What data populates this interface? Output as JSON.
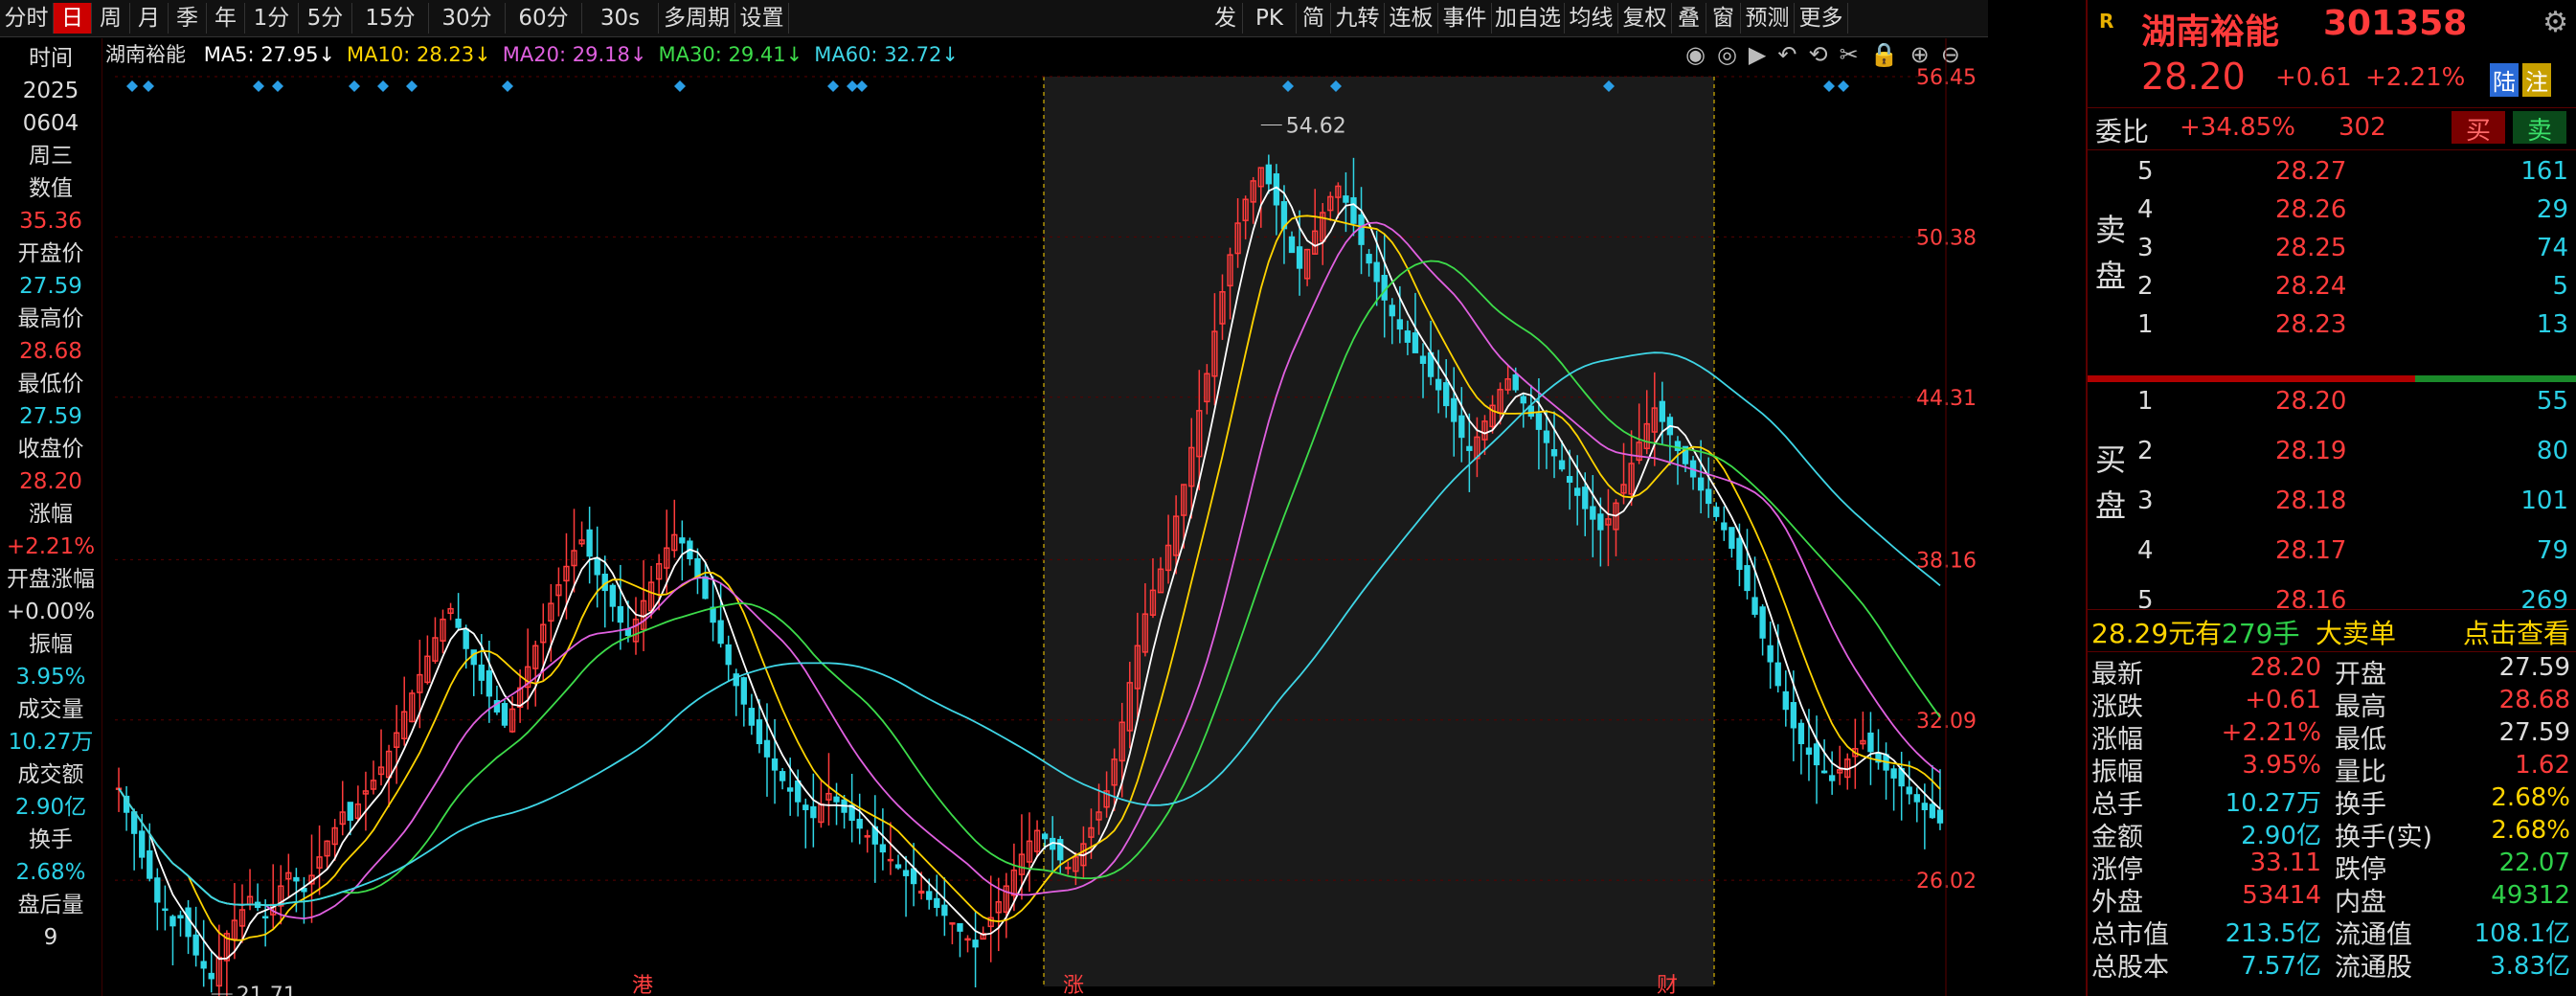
{
  "toolbar": {
    "items": [
      "分时",
      "日",
      "周",
      "月",
      "季",
      "年",
      "1分",
      "5分",
      "15分",
      "30分",
      "60分",
      "30s",
      "多周期",
      "设置"
    ],
    "active": "日",
    "right_items": [
      "发",
      "PK",
      "简",
      "九转",
      "连板",
      "事件",
      "加自选",
      "均线",
      "复权",
      "叠",
      "窗",
      "预测",
      "更多"
    ]
  },
  "left_panel": {
    "rows": [
      {
        "label": "时间",
        "value": "2025"
      },
      {
        "label": "",
        "value": "0604"
      },
      {
        "label": "周三",
        "value": ""
      },
      {
        "label": "数值",
        "value": "35.36"
      },
      {
        "label": "开盘价",
        "value": "27.59"
      },
      {
        "label": "最高价",
        "value": "28.68"
      },
      {
        "label": "最低价",
        "value": "27.59"
      },
      {
        "label": "收盘价",
        "value": "28.20"
      },
      {
        "label": "涨幅",
        "value": "+2.21%"
      },
      {
        "label": "开盘涨幅",
        "value": "+0.00%"
      },
      {
        "label": "振幅",
        "value": "3.95%"
      },
      {
        "label": "成交量",
        "value": "10.27万"
      },
      {
        "label": "成交额",
        "value": "2.90亿"
      },
      {
        "label": "换手",
        "value": "2.68%"
      },
      {
        "label": "盘后量",
        "value": "9"
      }
    ]
  },
  "chart_header": {
    "stock": "湖南裕能",
    "ma": [
      {
        "name": "MA5",
        "value": "27.95",
        "arrow": "↓",
        "color": "#ffffff"
      },
      {
        "name": "MA10",
        "value": "28.23",
        "arrow": "↓",
        "color": "#ffd400"
      },
      {
        "name": "MA20",
        "value": "29.18",
        "arrow": "↓",
        "color": "#e060e0"
      },
      {
        "name": "MA30",
        "value": "29.41",
        "arrow": "↓",
        "color": "#3ddc4a"
      },
      {
        "name": "MA60",
        "value": "32.72",
        "arrow": "↓",
        "color": "#3fd6e6"
      }
    ]
  },
  "chart_data": {
    "type": "candlestick",
    "y_ticks": [
      "56.45",
      "50.38",
      "44.31",
      "38.16",
      "32.09",
      "26.02"
    ],
    "ylim": [
      22.0,
      56.45
    ],
    "high_label": "54.62",
    "low_label": "21.71",
    "bottom_marks": [
      "涨",
      "财",
      "港"
    ],
    "closes": [
      29.5,
      28.6,
      27.8,
      26.9,
      26.1,
      25.2,
      24.9,
      24.3,
      24.6,
      23.9,
      23.2,
      22.7,
      22.3,
      23.1,
      24.0,
      24.5,
      24.9,
      25.4,
      25.0,
      24.6,
      25.1,
      25.8,
      26.3,
      26.0,
      25.6,
      26.2,
      26.9,
      27.5,
      28.0,
      28.6,
      28.3,
      28.9,
      29.4,
      29.8,
      30.3,
      30.9,
      31.6,
      32.4,
      33.1,
      33.8,
      34.5,
      35.2,
      35.9,
      36.3,
      35.6,
      34.8,
      34.2,
      33.6,
      33.0,
      32.4,
      31.9,
      32.5,
      33.3,
      34.1,
      34.9,
      35.7,
      36.5,
      37.2,
      37.9,
      38.5,
      38.9,
      38.3,
      37.6,
      37.0,
      36.4,
      35.8,
      35.3,
      35.9,
      36.6,
      37.3,
      38.0,
      38.6,
      39.1,
      38.8,
      38.2,
      37.5,
      36.7,
      35.8,
      35.0,
      34.2,
      33.4,
      32.7,
      31.9,
      31.2,
      30.7,
      30.2,
      29.8,
      29.4,
      29.0,
      28.7,
      28.4,
      28.9,
      29.3,
      29.0,
      28.6,
      28.3,
      28.0,
      27.7,
      27.4,
      27.1,
      26.8,
      26.5,
      26.2,
      25.9,
      25.6,
      25.3,
      25.0,
      24.7,
      24.4,
      24.1,
      23.8,
      23.5,
      24.0,
      24.6,
      25.2,
      25.8,
      26.4,
      27.0,
      27.5,
      27.9,
      27.6,
      27.2,
      26.8,
      26.5,
      26.9,
      27.4,
      28.0,
      28.6,
      29.4,
      30.6,
      32.0,
      33.5,
      34.9,
      36.1,
      37.0,
      37.8,
      38.7,
      39.8,
      41.0,
      42.4,
      43.8,
      45.2,
      46.8,
      48.3,
      49.7,
      50.9,
      51.8,
      52.5,
      53.0,
      52.4,
      51.6,
      50.7,
      49.8,
      49.2,
      49.9,
      50.6,
      51.3,
      51.9,
      52.3,
      51.7,
      50.9,
      50.1,
      49.4,
      48.7,
      48.0,
      47.4,
      46.9,
      46.4,
      46.0,
      45.6,
      45.1,
      44.6,
      44.0,
      43.4,
      42.8,
      42.3,
      42.8,
      43.4,
      44.0,
      44.6,
      45.0,
      44.6,
      44.1,
      43.6,
      43.1,
      42.6,
      42.1,
      41.6,
      41.1,
      40.6,
      40.1,
      39.7,
      39.3,
      39.7,
      40.3,
      41.0,
      41.8,
      42.6,
      43.3,
      43.9,
      43.4,
      42.9,
      42.3,
      41.8,
      41.3,
      40.8,
      40.3,
      39.8,
      39.3,
      38.6,
      37.8,
      37.0,
      36.1,
      35.2,
      34.3,
      33.4,
      32.5,
      31.8,
      31.2,
      30.8,
      30.4,
      30.1,
      29.8,
      30.2,
      30.6,
      31.0,
      31.3,
      30.9,
      30.5,
      30.2,
      29.9,
      29.6,
      29.3,
      29.0,
      28.7,
      28.4,
      28.2
    ]
  },
  "chart_toolbar_icons": [
    "eye-icon",
    "target-icon",
    "play-icon",
    "undo-icon",
    "rotate-icon",
    "scissors-icon",
    "lock-icon",
    "zoom-in-icon",
    "zoom-out-icon"
  ],
  "right_panel": {
    "badge": "R",
    "name": "湖南裕能",
    "code": "301358",
    "price": "28.20",
    "change": "+0.61",
    "change_pct": "+2.21%",
    "tags": [
      "陆",
      "注"
    ],
    "weibi_label": "委比",
    "weibi": "+34.85%",
    "weicha": "302",
    "buy_label": "买",
    "sell_label": "卖",
    "sell_side_label": "卖盘",
    "buy_side_label": "买盘",
    "asks": [
      {
        "level": "5",
        "price": "28.27",
        "vol": "161"
      },
      {
        "level": "4",
        "price": "28.26",
        "vol": "29"
      },
      {
        "level": "3",
        "price": "28.25",
        "vol": "74"
      },
      {
        "level": "2",
        "price": "28.24",
        "vol": "5"
      },
      {
        "level": "1",
        "price": "28.23",
        "vol": "13"
      }
    ],
    "bids": [
      {
        "level": "1",
        "price": "28.20",
        "vol": "55"
      },
      {
        "level": "2",
        "price": "28.19",
        "vol": "80"
      },
      {
        "level": "3",
        "price": "28.18",
        "vol": "101"
      },
      {
        "level": "4",
        "price": "28.17",
        "vol": "79"
      },
      {
        "level": "5",
        "price": "28.16",
        "vol": "269"
      }
    ],
    "big_order": {
      "price": "28.29元有",
      "lots": "279手",
      "type": "大卖单",
      "action": "点击查看"
    },
    "stats": [
      {
        "k1": "最新",
        "v1": "28.20",
        "c1": "red",
        "k2": "开盘",
        "v2": "27.59",
        "c2": "white"
      },
      {
        "k1": "涨跌",
        "v1": "+0.61",
        "c1": "red",
        "k2": "最高",
        "v2": "28.68",
        "c2": "red"
      },
      {
        "k1": "涨幅",
        "v1": "+2.21%",
        "c1": "red",
        "k2": "最低",
        "v2": "27.59",
        "c2": "white"
      },
      {
        "k1": "振幅",
        "v1": "3.95%",
        "c1": "red",
        "k2": "量比",
        "v2": "1.62",
        "c2": "red"
      },
      {
        "k1": "总手",
        "v1": "10.27万",
        "c1": "cyan",
        "k2": "换手",
        "v2": "2.68%",
        "c2": "yellow"
      },
      {
        "k1": "金额",
        "v1": "2.90亿",
        "c1": "cyan",
        "k2": "换手(实)",
        "v2": "2.68%",
        "c2": "yellow"
      },
      {
        "k1": "涨停",
        "v1": "33.11",
        "c1": "red",
        "k2": "跌停",
        "v2": "22.07",
        "c2": "green"
      },
      {
        "k1": "外盘",
        "v1": "53414",
        "c1": "red",
        "k2": "内盘",
        "v2": "49312",
        "c2": "green"
      },
      {
        "k1": "总市值",
        "v1": "213.5亿",
        "c1": "cyan",
        "k2": "流通值",
        "v2": "108.1亿",
        "c2": "cyan"
      },
      {
        "k1": "总股本",
        "v1": "7.57亿",
        "c1": "cyan",
        "k2": "流通股",
        "v2": "3.83亿",
        "c2": "cyan"
      }
    ]
  }
}
